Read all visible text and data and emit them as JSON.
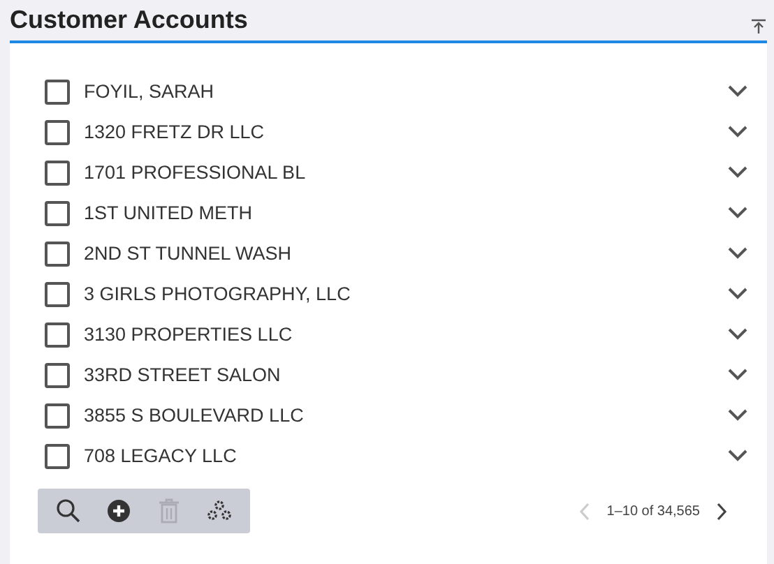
{
  "panel": {
    "title": "Customer Accounts"
  },
  "accounts": [
    {
      "name": "FOYIL, SARAH",
      "checked": false
    },
    {
      "name": "1320 FRETZ DR LLC",
      "checked": false
    },
    {
      "name": "1701 PROFESSIONAL BL",
      "checked": false
    },
    {
      "name": "1ST UNITED METH",
      "checked": false
    },
    {
      "name": "2ND ST TUNNEL WASH",
      "checked": false
    },
    {
      "name": "3 GIRLS PHOTOGRAPHY, LLC",
      "checked": false
    },
    {
      "name": "3130 PROPERTIES LLC",
      "checked": false
    },
    {
      "name": "33RD STREET SALON",
      "checked": false
    },
    {
      "name": "3855 S BOULEVARD LLC",
      "checked": false
    },
    {
      "name": "708 LEGACY LLC",
      "checked": false
    }
  ],
  "toolbar": [
    {
      "kind": "search",
      "disabled": false
    },
    {
      "kind": "add",
      "disabled": false
    },
    {
      "kind": "delete",
      "disabled": true
    },
    {
      "kind": "settings",
      "disabled": false
    }
  ],
  "pagination": {
    "range": "1–10 of 34,565",
    "prev_disabled": true,
    "next_disabled": false
  }
}
